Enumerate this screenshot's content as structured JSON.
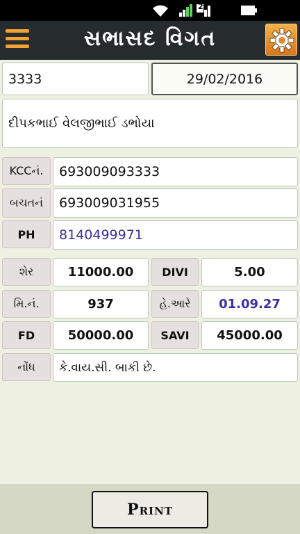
{
  "status_bar": {
    "icons": [
      "wifi-icon",
      "signal-icon",
      "battery-icon"
    ],
    "sim_badge": "2"
  },
  "app_bar": {
    "title": "સભાસદ વિગત",
    "menu_icon": "hamburger-menu-icon",
    "settings_icon": "gear-icon",
    "accent_color": "#f4a233"
  },
  "member": {
    "number": "3333",
    "date": "29/02/2016",
    "name": "દીપકભાઈ વેલજીભાઈ ડભોયા"
  },
  "fields": {
    "kcc_label": "KCCનં.",
    "kcc_value": "693009093333",
    "savings_label": "બચતનં",
    "savings_value": "693009031955",
    "phone_label": "PH",
    "phone_value": "8140499971",
    "share_label": "શેર",
    "share_value": "11000.00",
    "divi_label": "DIVI",
    "divi_value": "5.00",
    "min_label": "મિ.નં.",
    "min_value": "937",
    "he_label": "હે.આરે",
    "he_value": "01.09.27",
    "fd_label": "FD",
    "fd_value": "50000.00",
    "savi_label": "SAVI",
    "savi_value": "45000.00",
    "note_label": "નોંધ",
    "note_value": "કે.વાય.સી. બાકી છે."
  },
  "actions": {
    "print_label": "Print"
  }
}
